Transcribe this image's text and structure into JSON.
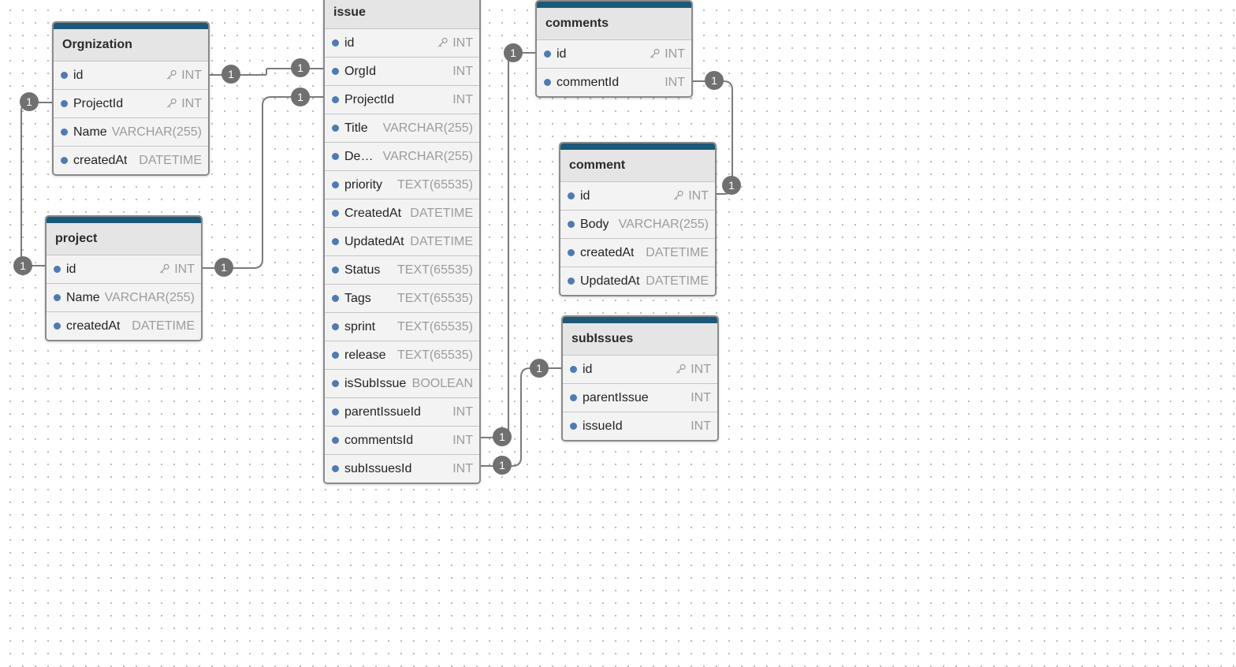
{
  "colors": {
    "header_bar": "#1c5978",
    "field_dot": "#4f7ab3",
    "badge": "#707070",
    "connector": "#7a7a7a",
    "type_text": "#9c9c9c"
  },
  "icons": {
    "primary_key": "key-icon",
    "field": "field-dot-icon",
    "cardinality": "cardinality-badge"
  },
  "tables": [
    {
      "name": "Orgnization",
      "fields": [
        {
          "name": "id",
          "type": "INT",
          "pk": true
        },
        {
          "name": "ProjectId",
          "type": "INT",
          "pk": true
        },
        {
          "name": "Name",
          "type": "VARCHAR(255)"
        },
        {
          "name": "createdAt",
          "type": "DATETIME"
        }
      ]
    },
    {
      "name": "project",
      "fields": [
        {
          "name": "id",
          "type": "INT",
          "pk": true
        },
        {
          "name": "Name",
          "type": "VARCHAR(255)"
        },
        {
          "name": "createdAt",
          "type": "DATETIME"
        }
      ]
    },
    {
      "name": "issue",
      "fields": [
        {
          "name": "id",
          "type": "INT",
          "pk": true
        },
        {
          "name": "OrgId",
          "type": "INT"
        },
        {
          "name": "ProjectId",
          "type": "INT"
        },
        {
          "name": "Title",
          "type": "VARCHAR(255)"
        },
        {
          "name": "De…",
          "type": "VARCHAR(255)"
        },
        {
          "name": "priority",
          "type": "TEXT(65535)"
        },
        {
          "name": "CreatedAt",
          "type": "DATETIME"
        },
        {
          "name": "UpdatedAt",
          "type": "DATETIME"
        },
        {
          "name": "Status",
          "type": "TEXT(65535)"
        },
        {
          "name": "Tags",
          "type": "TEXT(65535)"
        },
        {
          "name": "sprint",
          "type": "TEXT(65535)"
        },
        {
          "name": "release",
          "type": "TEXT(65535)"
        },
        {
          "name": "isSubIssue",
          "type": "BOOLEAN"
        },
        {
          "name": "parentIssueId",
          "type": "INT"
        },
        {
          "name": "commentsId",
          "type": "INT"
        },
        {
          "name": "subIssuesId",
          "type": "INT"
        }
      ]
    },
    {
      "name": "comments",
      "fields": [
        {
          "name": "id",
          "type": "INT",
          "pk": true
        },
        {
          "name": "commentId",
          "type": "INT"
        }
      ]
    },
    {
      "name": "comment",
      "fields": [
        {
          "name": "id",
          "type": "INT",
          "pk": true
        },
        {
          "name": "Body",
          "type": "VARCHAR(255)"
        },
        {
          "name": "createdAt",
          "type": "DATETIME"
        },
        {
          "name": "UpdatedAt",
          "type": "DATETIME"
        }
      ]
    },
    {
      "name": "subIssues",
      "fields": [
        {
          "name": "id",
          "type": "INT",
          "pk": true
        },
        {
          "name": "parentIssue",
          "type": "INT"
        },
        {
          "name": "issueId",
          "type": "INT"
        }
      ]
    }
  ],
  "relations": [
    {
      "from": "Orgnization.id",
      "to": "issue.OrgId",
      "from_card": "1",
      "to_card": "1"
    },
    {
      "from": "Orgnization.ProjectId",
      "to": "project.id",
      "from_card": "1",
      "to_card": "1"
    },
    {
      "from": "project.id",
      "to": "issue.ProjectId",
      "from_card": "1",
      "to_card": "1"
    },
    {
      "from": "issue.commentsId",
      "to": "comments.id",
      "from_card": "1",
      "to_card": "1"
    },
    {
      "from": "comments.commentId",
      "to": "comment.id",
      "from_card": "1",
      "to_card": "1"
    },
    {
      "from": "issue.subIssuesId",
      "to": "subIssues.id",
      "from_card": "1",
      "to_card": "1"
    }
  ]
}
